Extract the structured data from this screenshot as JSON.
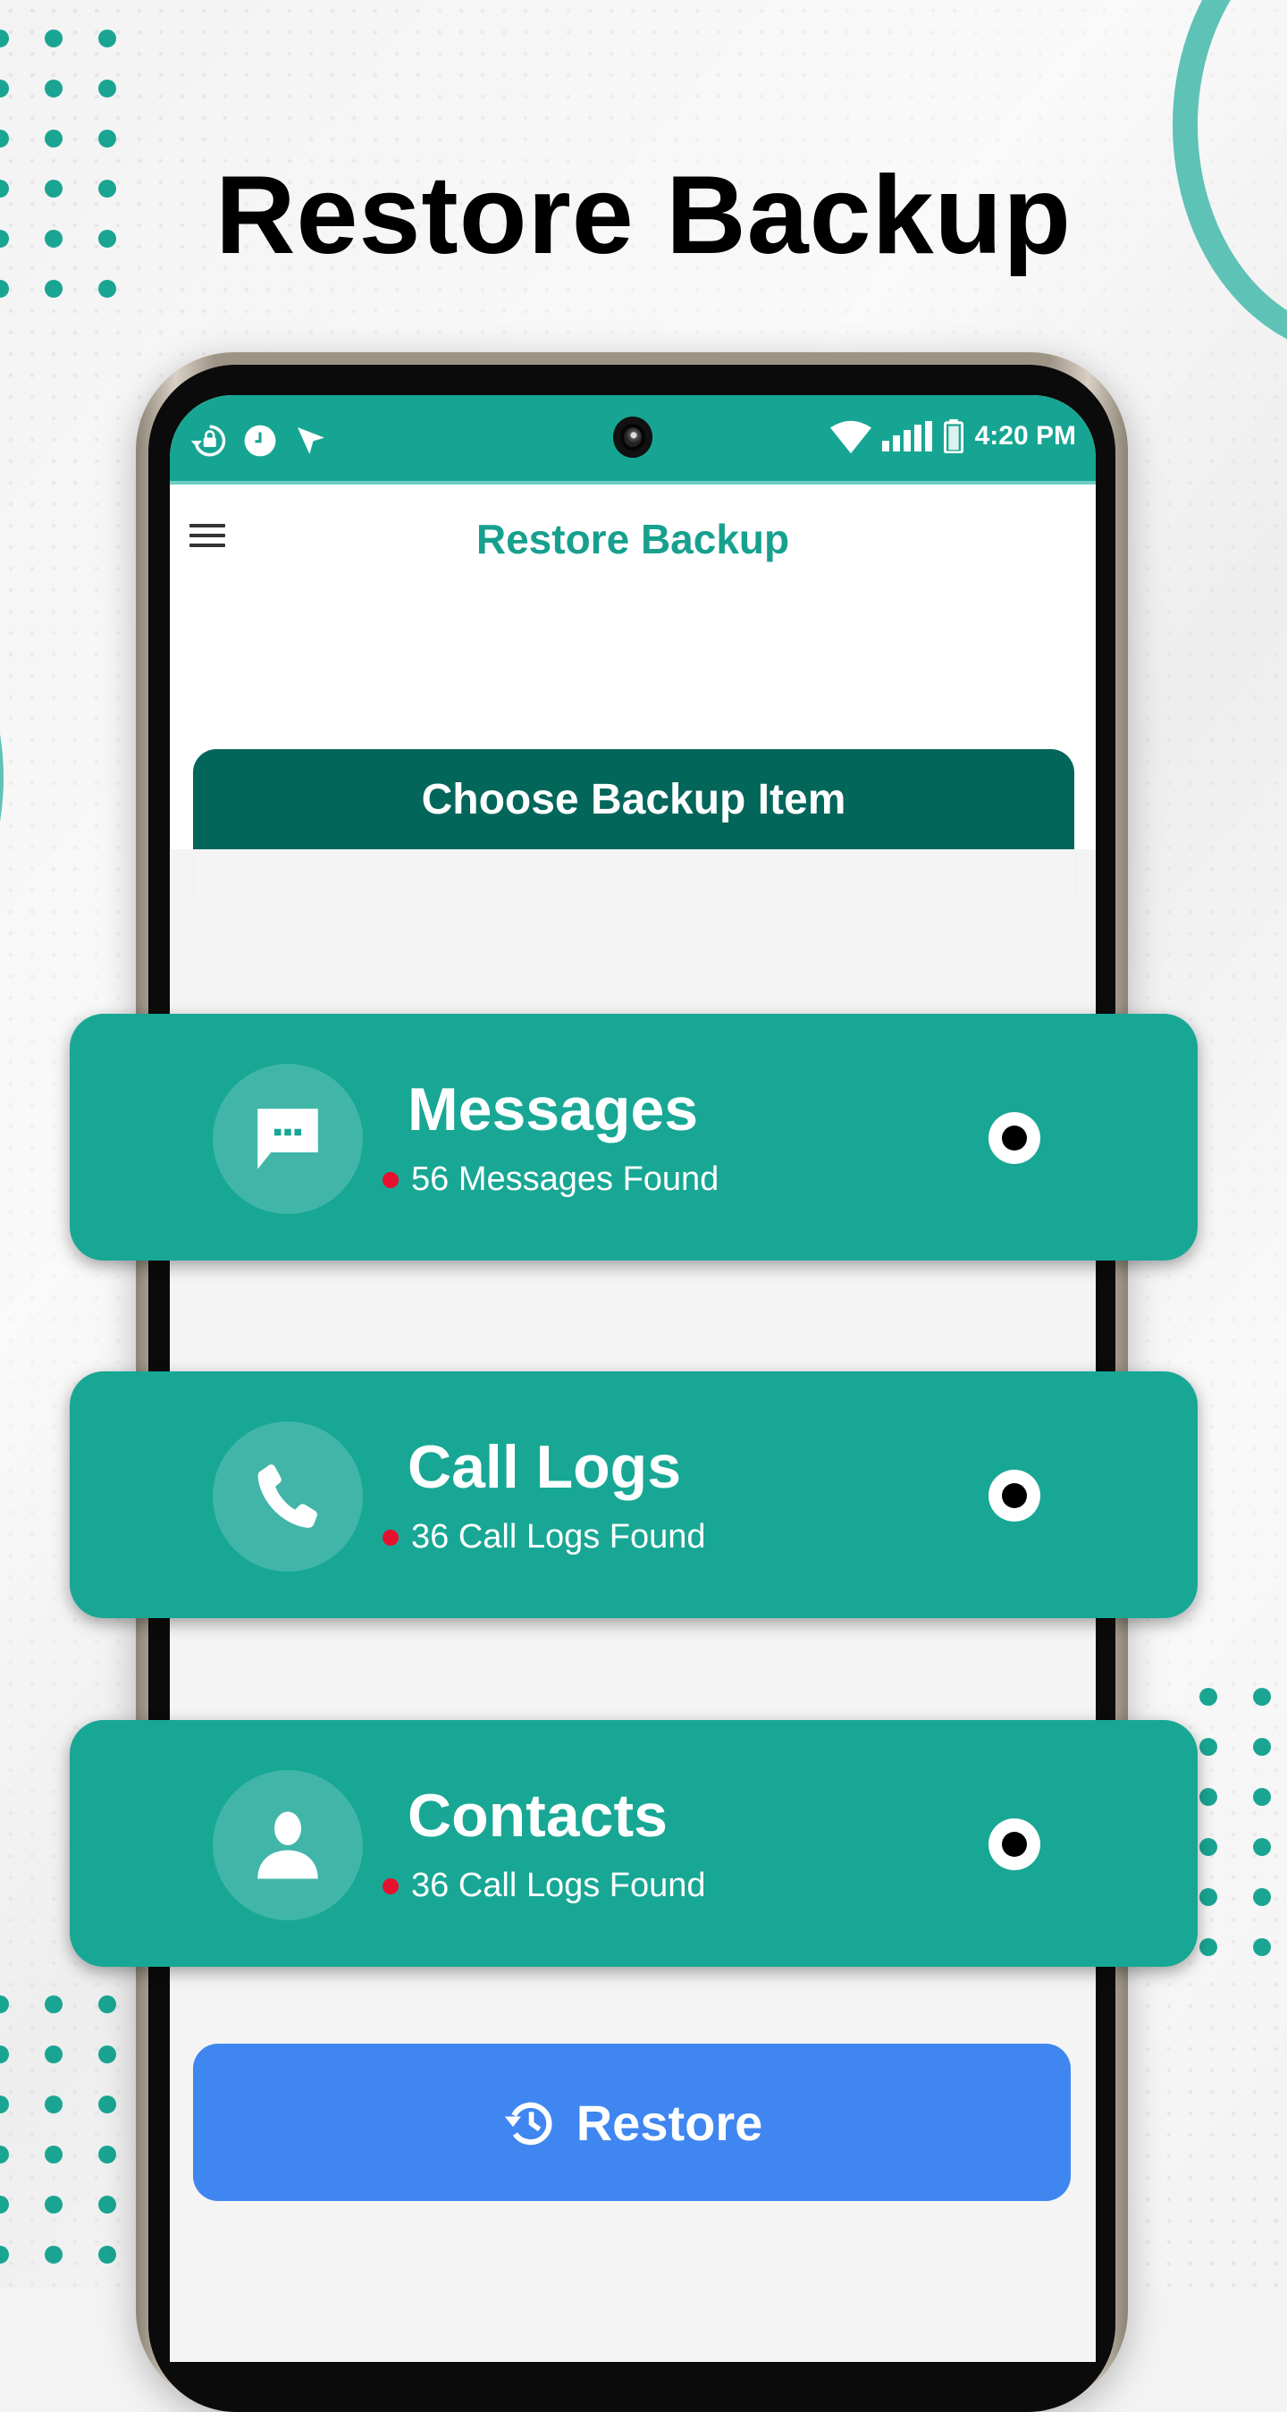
{
  "headline": "Restore Backup",
  "status_bar": {
    "left_icons": [
      "restore-lock-icon",
      "clock-icon",
      "location-arrow-icon"
    ],
    "right_icons": [
      "wifi-icon",
      "signal-icon",
      "battery-icon"
    ],
    "time": "4:20 PM"
  },
  "app_bar": {
    "menu_icon": "hamburger-menu-icon",
    "title": "Restore Backup"
  },
  "section": {
    "title": "Choose Backup Item"
  },
  "items": [
    {
      "title": "Messages",
      "subtitle": "56 Messages Found",
      "icon": "message-icon",
      "selected": true
    },
    {
      "title": "Call Logs",
      "subtitle": "36 Call Logs Found",
      "icon": "phone-icon",
      "selected": true
    },
    {
      "title": "Contacts",
      "subtitle": "36 Call Logs Found",
      "icon": "contact-person-icon",
      "selected": true
    }
  ],
  "restore_button": {
    "label": "Restore",
    "icon": "history-restore-icon"
  },
  "colors": {
    "accent_teal": "#18a795",
    "header_dark_teal": "#03665a",
    "button_blue": "#3f86f0",
    "status_red": "#e8102c",
    "decor_teal": "#5fc2b6"
  }
}
